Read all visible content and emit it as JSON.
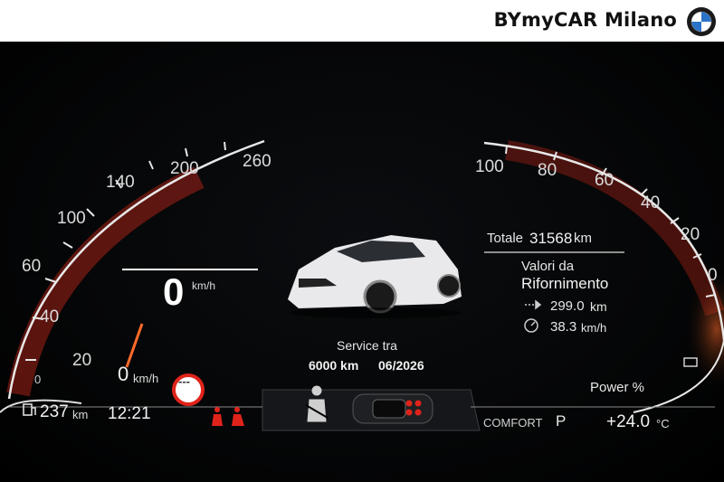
{
  "header": {
    "dealer_name": "BYmyCAR Milano",
    "logo_icon": "bmw-roundel-icon"
  },
  "speedometer": {
    "ticks": [
      "260",
      "200",
      "140",
      "100",
      "60",
      "40",
      "20",
      "0"
    ],
    "speed_value": "0",
    "speed_unit": "km/h",
    "limit_value": "0",
    "limit_unit": "km/h"
  },
  "tachometer": {
    "ticks": [
      "100",
      "80",
      "60",
      "40",
      "20",
      "0"
    ],
    "power_label": "Power %"
  },
  "odometer": {
    "total_label": "Totale",
    "total_value": "31568",
    "total_unit": "km"
  },
  "trip": {
    "title_line1": "Valori da",
    "title_line2": "Rifornimento",
    "distance_value": "299.0",
    "distance_unit": "km",
    "avg_speed_value": "38.3",
    "avg_speed_unit": "km/h"
  },
  "service": {
    "label": "Service tra",
    "distance": "6000 km",
    "date": "06/2026"
  },
  "status_bar": {
    "range_value": "237",
    "range_unit": "km",
    "time": "12:21",
    "drive_mode": "COMFORT",
    "gear": "P",
    "temperature": "+24.0",
    "temperature_unit": "°C"
  },
  "warnings": {
    "no_limit_sign": "---"
  },
  "colors": {
    "accent_red": "#e0231a",
    "glow_orange": "#ff5a2a",
    "white": "#ffffff"
  }
}
